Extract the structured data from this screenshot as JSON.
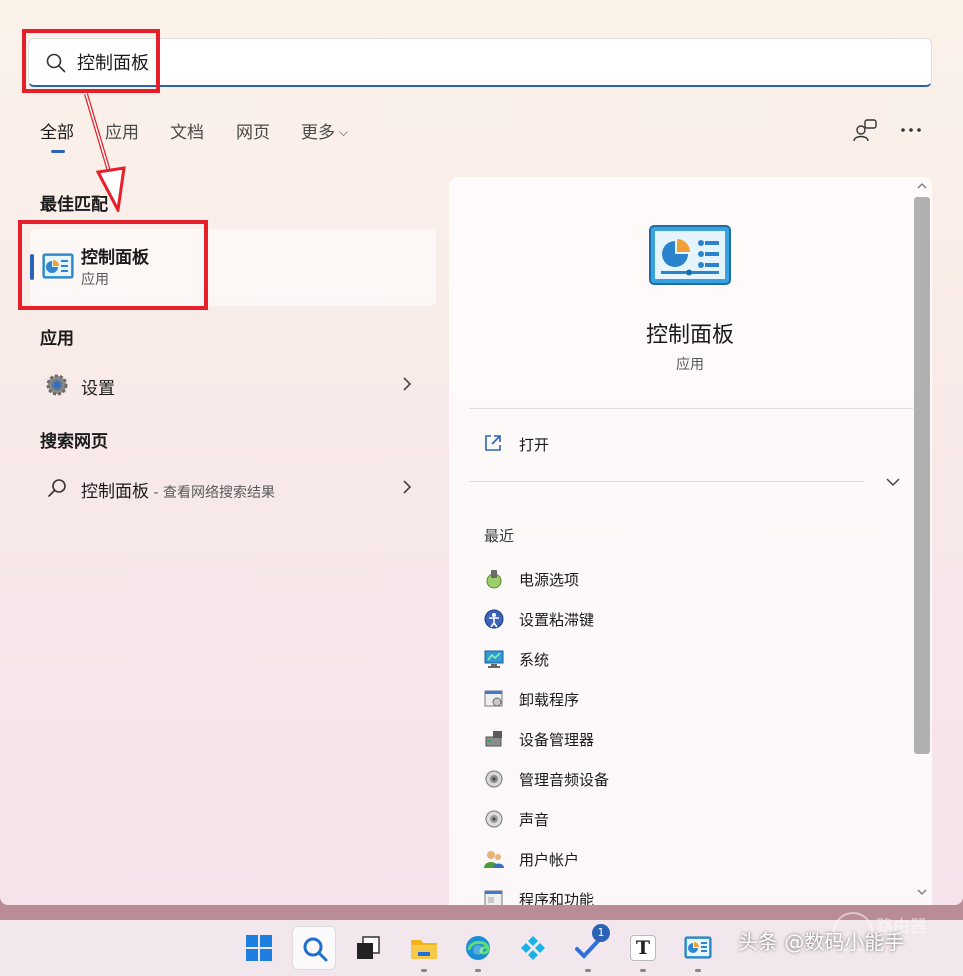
{
  "search": {
    "value": "控制面板"
  },
  "tabs": [
    {
      "label": "全部"
    },
    {
      "label": "应用"
    },
    {
      "label": "文档"
    },
    {
      "label": "网页"
    },
    {
      "label": "更多"
    }
  ],
  "top_right_icons": [
    "people-icon",
    "more-options-icon"
  ],
  "best_match": {
    "section_title": "最佳匹配",
    "title": "控制面板",
    "subtitle": "应用",
    "icon": "control-panel-icon"
  },
  "apps": {
    "section_title": "应用",
    "items": [
      {
        "label": "设置",
        "icon": "settings-gear-icon"
      }
    ]
  },
  "web": {
    "section_title": "搜索网页",
    "items": [
      {
        "label": "控制面板",
        "hint": " - 查看网络搜索结果",
        "icon": "search-icon"
      }
    ]
  },
  "detail": {
    "title": "控制面板",
    "subtitle": "应用",
    "open_label": "打开",
    "recent_title": "最近",
    "recent": [
      {
        "label": "电源选项",
        "icon": "power-options-icon"
      },
      {
        "label": "设置粘滞键",
        "icon": "sticky-keys-icon"
      },
      {
        "label": "系统",
        "icon": "system-monitor-icon"
      },
      {
        "label": "卸载程序",
        "icon": "uninstall-program-icon"
      },
      {
        "label": "设备管理器",
        "icon": "device-manager-icon"
      },
      {
        "label": "管理音频设备",
        "icon": "audio-device-icon"
      },
      {
        "label": "声音",
        "icon": "sound-icon"
      },
      {
        "label": "用户帐户",
        "icon": "user-accounts-icon"
      },
      {
        "label": "程序和功能",
        "icon": "programs-features-icon"
      }
    ]
  },
  "taskbar": {
    "items": [
      {
        "name": "start-icon"
      },
      {
        "name": "search-icon",
        "active": true
      },
      {
        "name": "task-view-icon"
      },
      {
        "name": "file-explorer-icon"
      },
      {
        "name": "edge-browser-icon"
      },
      {
        "name": "kodi-icon"
      },
      {
        "name": "todo-icon",
        "badge": "1"
      },
      {
        "name": "typora-icon",
        "letter": "T"
      },
      {
        "name": "control-panel-icon"
      }
    ]
  },
  "watermark": {
    "primary": "头条 @数码小能手",
    "secondary": "路由器"
  },
  "colors": {
    "accent": "#2b63b6",
    "annotation_red": "#e6202a"
  }
}
